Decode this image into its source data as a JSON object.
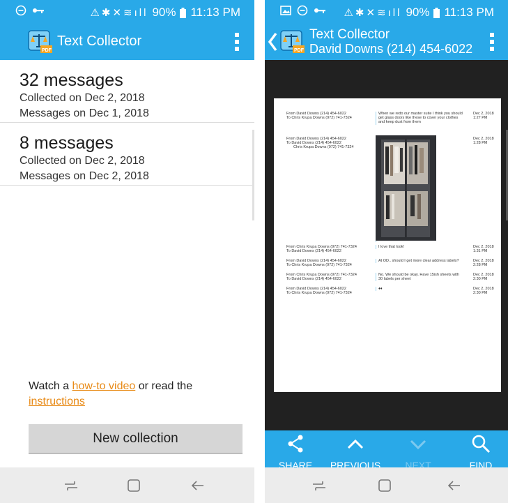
{
  "status_bar": {
    "battery": "90%",
    "time": "11:13 PM"
  },
  "left": {
    "app_title": "Text Collector",
    "collections": [
      {
        "count": "32 messages",
        "collected": "Collected on Dec 2, 2018",
        "messages_on": "Messages on Dec 1, 2018"
      },
      {
        "count": "8 messages",
        "collected": "Collected on Dec 2, 2018",
        "messages_on": "Messages on Dec 2, 2018"
      }
    ],
    "help": {
      "prefix": "Watch a ",
      "video_link": "how-to video",
      "middle": " or read the",
      "instructions_link": "instructions"
    },
    "new_collection_label": "New collection"
  },
  "right": {
    "app_title": "Text Collector",
    "contact": "David Downs (214) 454-6022",
    "doc_rows": [
      {
        "from": "From David Downs (214) 454-6022",
        "to": "To Chris Krupa Downs (972) 741-7324",
        "to2": "",
        "message": "When we redo our master suite I think you should get glass doors like these to cover your clothes and keep dust from them",
        "date": "Dec 2, 2018",
        "time": "1:27 PM"
      },
      {
        "from": "From David Downs (214) 454-6022",
        "to": "To David Downs (214) 454-6022",
        "to2": "Chris Krupa Downs (972) 741-7324",
        "message": "",
        "date": "Dec 2, 2018",
        "time": "1:28 PM"
      },
      {
        "from": "From Chris Krupa Downs (972) 741-7324",
        "to": "To David Downs (214) 454-6022",
        "to2": "",
        "message": "I love that look!",
        "date": "Dec 2, 2018",
        "time": "1:31 PM"
      },
      {
        "from": "From David Downs (214) 454-6022",
        "to": "To Chris Krupa Downs (972) 741-7324",
        "to2": "",
        "message": "At OD.. should I get more clear address labels?",
        "date": "Dec 2, 2018",
        "time": "2:28 PM"
      },
      {
        "from": "From Chris Krupa Downs (972) 741-7324",
        "to": "To David Downs (214) 454-6022",
        "to2": "",
        "message": "No. We should be okay. Have 15ish sheets with 30 labels per sheet",
        "date": "Dec 2, 2018",
        "time": "2:30 PM"
      },
      {
        "from": "From David Downs (214) 454-6022",
        "to": "To Chris Krupa Downs (972) 741-7324",
        "to2": "",
        "message": "♦♦",
        "date": "Dec 2, 2018",
        "time": "2:30 PM"
      }
    ],
    "toolbar": {
      "share": "SHARE",
      "previous": "PREVIOUS",
      "next": "NEXT",
      "find": "FIND"
    }
  },
  "colors": {
    "accent": "#29a9e8",
    "link": "#e88a16",
    "doc_bg": "#212121"
  }
}
